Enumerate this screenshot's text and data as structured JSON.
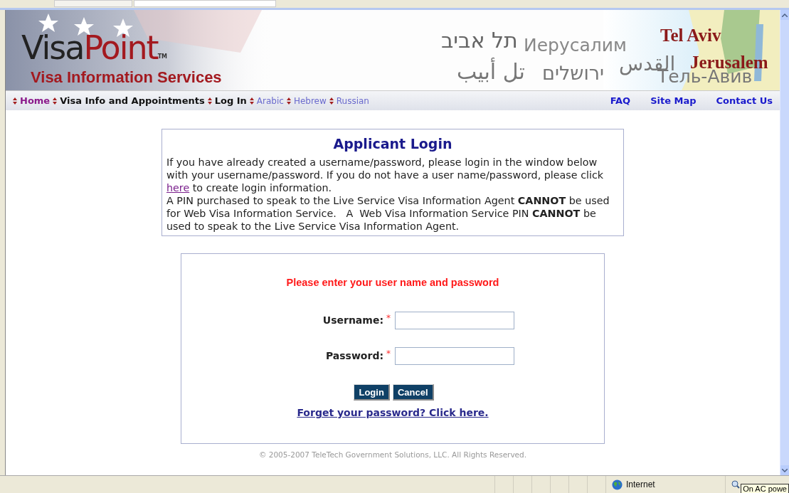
{
  "banner": {
    "logo": {
      "first": "Visa",
      "second": "Point",
      "mark": "TM"
    },
    "tagline": "Visa Information Services",
    "city_names": [
      {
        "text": "תל אביב",
        "kind": "plain"
      },
      {
        "text": "Иерусалим",
        "kind": "plain"
      },
      {
        "text": "تل أبيب",
        "kind": "plain"
      },
      {
        "text": "ירושלים",
        "kind": "plain"
      },
      {
        "text": "القدس",
        "kind": "plain"
      },
      {
        "text": "Tel Aviv",
        "kind": "accent"
      },
      {
        "text": "Jerusalem",
        "kind": "accent"
      },
      {
        "text": "Тель-Авив",
        "kind": "plain"
      }
    ]
  },
  "nav": {
    "items": [
      {
        "label": "Home",
        "kind": "visited"
      },
      {
        "label": "Visa Info and Appointments",
        "kind": "main"
      },
      {
        "label": "Log In",
        "kind": "main"
      },
      {
        "label": "Arabic",
        "kind": "language"
      },
      {
        "label": "Hebrew",
        "kind": "language"
      },
      {
        "label": "Russian",
        "kind": "language"
      }
    ],
    "right_links": [
      "FAQ",
      "Site Map",
      "Contact Us"
    ]
  },
  "info": {
    "title": "Applicant Login",
    "before_link": "If you have already created a username/password, please login in the window below with your username/password. If you do not have a user name/password, please click",
    "link": "here",
    "after_link": "to create login information.",
    "note": "A PIN purchased to speak to the Live Service Visa Information Agent **CANNOT** be used for Web Visa Information Service.   A  Web Visa Information Service PIN **CANNOT** be used to speak to the Live Service Visa Information Agent."
  },
  "form": {
    "prompt": "Please enter your user name and password",
    "fields": [
      {
        "label": "Username:",
        "required": true
      },
      {
        "label": "Password:",
        "required": true
      }
    ],
    "required_mark": "*",
    "buttons": [
      "Login",
      "Cancel"
    ],
    "forgot_link": "Forget your password? Click here."
  },
  "footer": "© 2005-2007 TeleTech Government Solutions, LLC. All Rights Reserved.",
  "status_bar": {
    "zone": "Internet",
    "tooltip": "On AC powe"
  }
}
